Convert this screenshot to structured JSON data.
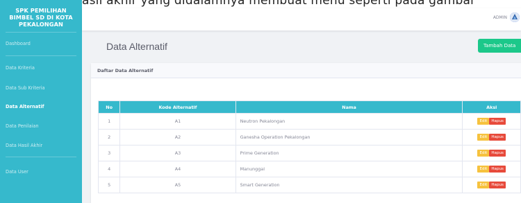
{
  "doc_fragment": "asil akhir yang didalamnya membuat menu seperti pada gambar",
  "sidebar": {
    "brand": "SPK PEMILIHAN BIMBEL SD DI KOTA PEKALONGAN",
    "items": [
      {
        "label": "Dashboard"
      },
      {
        "label": "Data Kriteria"
      },
      {
        "label": "Data Sub Kriteria"
      },
      {
        "label": "Data Alternatif",
        "active": true
      },
      {
        "label": "Data Penilaian"
      },
      {
        "label": "Data Hasil Akhir"
      },
      {
        "label": "Data User"
      }
    ]
  },
  "topbar": {
    "user": "ADMIN"
  },
  "page": {
    "title": "Data Alternatif",
    "add_button": "Tambah Data"
  },
  "card": {
    "title": "Daftar Data Alternatif"
  },
  "table": {
    "headers": [
      "No",
      "Kode Alternatif",
      "Nama",
      "Aksi"
    ],
    "rows": [
      {
        "no": "1",
        "kode": "A1",
        "nama": "Neutron Pekalongan"
      },
      {
        "no": "2",
        "kode": "A2",
        "nama": "Ganesha Operation Pekalongan"
      },
      {
        "no": "3",
        "kode": "A3",
        "nama": "Prime Generation"
      },
      {
        "no": "4",
        "kode": "A4",
        "nama": "Manunggal"
      },
      {
        "no": "5",
        "kode": "A5",
        "nama": "Smart Generation"
      }
    ],
    "edit_label": "Edit",
    "delete_label": "Hapus"
  },
  "colors": {
    "sidebar": "#36b9cc",
    "primary_add": "#1cc88a",
    "edit": "#f6c23e",
    "delete": "#e74a3b"
  }
}
